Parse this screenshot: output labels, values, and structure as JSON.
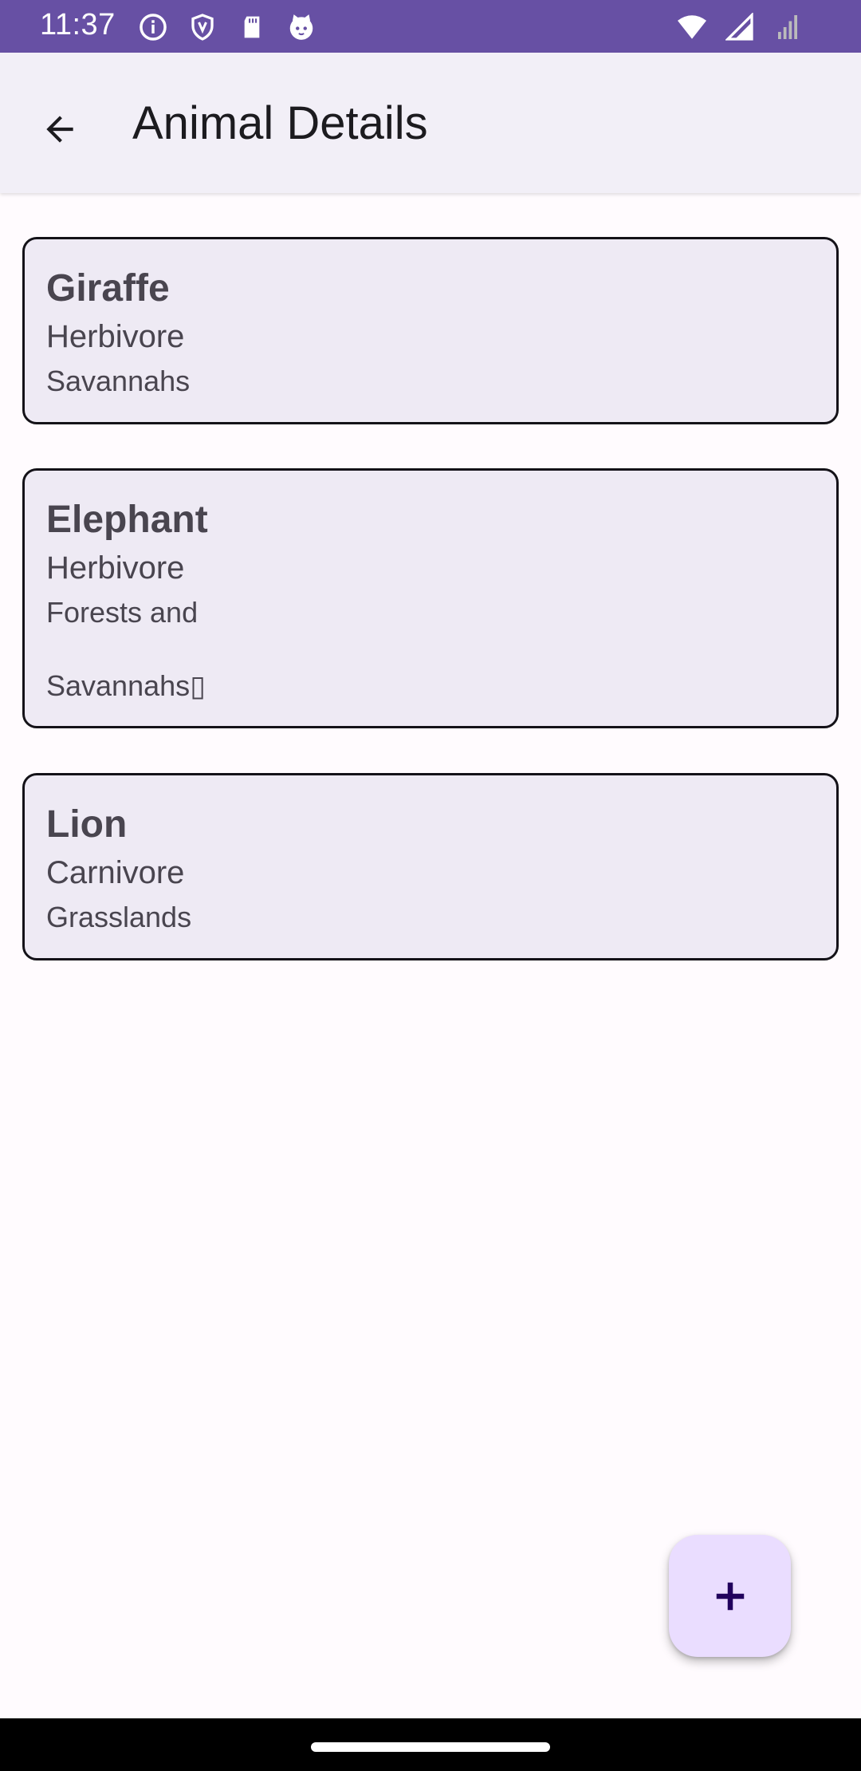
{
  "status_bar": {
    "time": "11:37",
    "left_icons": [
      "info-icon",
      "shield-icon",
      "sd-card-icon",
      "cat-face-icon"
    ],
    "right_icons": [
      "wifi-icon",
      "cell-signal-icon",
      "no-signal-icon"
    ]
  },
  "app_bar": {
    "title": "Animal Details",
    "back_icon": "arrow-back-icon"
  },
  "animals": [
    {
      "name": "Giraffe",
      "diet": "Herbivore",
      "habitat": "Savannahs"
    },
    {
      "name": "Elephant",
      "diet": "Herbivore",
      "habitat": "Forests and\nSavannahs▯"
    },
    {
      "name": "Lion",
      "diet": "Carnivore",
      "habitat": "Grasslands"
    }
  ],
  "fab": {
    "icon": "plus-icon"
  },
  "colors": {
    "primary": "#6750A4",
    "app_bar_bg": "#F2EFF7",
    "card_bg": "#EEEAF4",
    "fab_bg": "#EADDFF",
    "fab_icon": "#21005D"
  }
}
